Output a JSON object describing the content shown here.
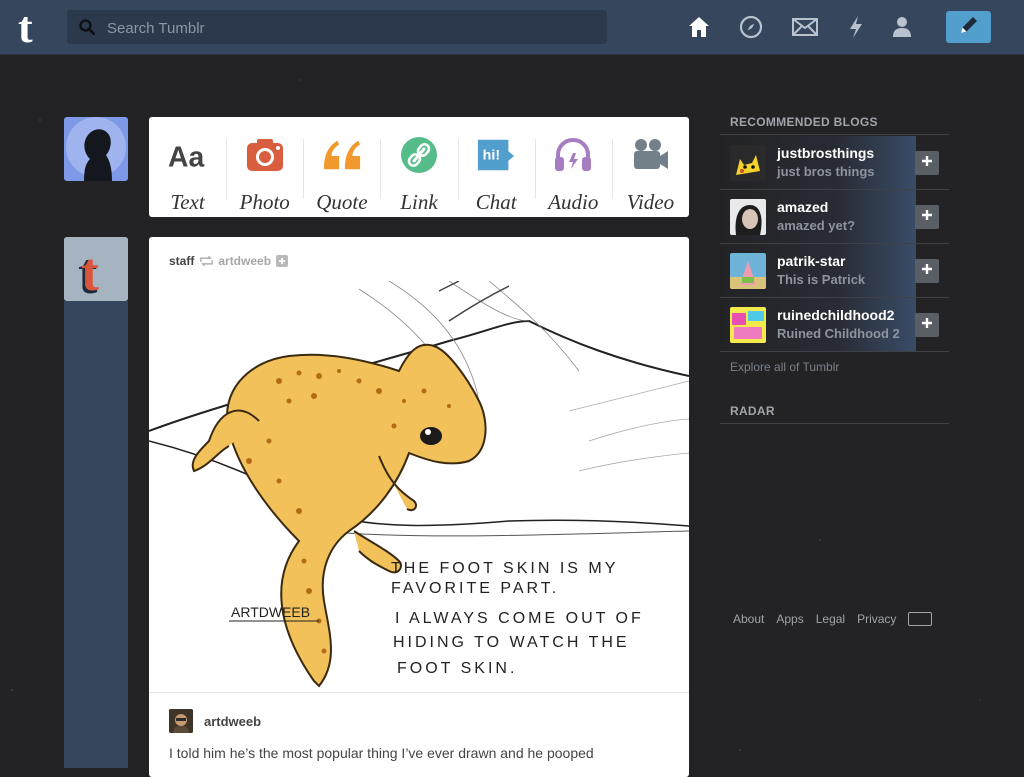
{
  "header": {
    "search_placeholder": "Search Tumblr",
    "nav_icons": [
      "home-icon",
      "explore-icon",
      "mail-icon",
      "activity-icon",
      "account-icon"
    ],
    "compose_icon": "pencil-icon"
  },
  "post_types": [
    {
      "label": "Text",
      "icon": "text-icon",
      "color": "#444444"
    },
    {
      "label": "Photo",
      "icon": "camera-icon",
      "color": "#d95e40"
    },
    {
      "label": "Quote",
      "icon": "quote-icon",
      "color": "#f2992e"
    },
    {
      "label": "Link",
      "icon": "link-icon",
      "color": "#56bc8a"
    },
    {
      "label": "Chat",
      "icon": "chat-icon",
      "color": "#529ecc"
    },
    {
      "label": "Audio",
      "icon": "headphones-icon",
      "color": "#a77dc2"
    },
    {
      "label": "Video",
      "icon": "video-camera-icon",
      "color": "#748089"
    }
  ],
  "post": {
    "author": "staff",
    "source": "artdweeb",
    "reblog_name": "artdweeb",
    "text": "I told him he’s the most popular thing I’ve ever drawn and he pooped",
    "drawing": {
      "signature": "ARTDWEEB",
      "caption_lines": [
        "THE FOOT SKIN IS MY",
        "FAVORITE PART.",
        "I ALWAYS COME OUT OF",
        "HIDING TO WATCH THE",
        "FOOT SKIN."
      ]
    }
  },
  "sidebar": {
    "recommended_heading": "RECOMMENDED BLOGS",
    "blogs": [
      {
        "name": "justbrosthings",
        "subtitle": "just bros things"
      },
      {
        "name": "amazed",
        "subtitle": "amazed yet?"
      },
      {
        "name": "patrik-star",
        "subtitle": "This is Patrick"
      },
      {
        "name": "ruinedchildhood2",
        "subtitle": "Ruined Childhood 2"
      }
    ],
    "explore_link": "Explore all of Tumblr",
    "radar_heading": "RADAR",
    "footer_links": [
      "About",
      "Apps",
      "Legal",
      "Privacy"
    ]
  },
  "colors": {
    "header_bg": "#36465d",
    "search_bg": "#2c394c",
    "compose_bg": "#529ecc",
    "page_bg": "#232326"
  }
}
